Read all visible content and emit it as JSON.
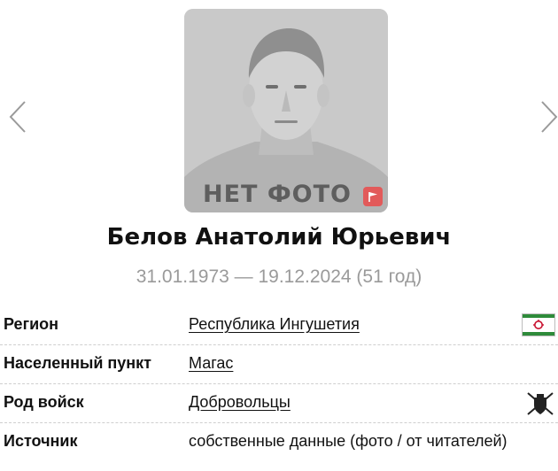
{
  "photo": {
    "placeholder_text": "НЕТ ФОТО"
  },
  "person": {
    "name": "Белов Анатолий Юрьевич",
    "dates": "31.01.1973 — 19.12.2024 (51 год)"
  },
  "info": [
    {
      "label": "Регион",
      "value": "Республика Ингушетия",
      "icon": "ingushetia-flag-icon"
    },
    {
      "label": "Населенный пункт",
      "value": "Магас"
    },
    {
      "label": "Род войск",
      "value": "Добровольцы",
      "icon": "volunteers-emblem-icon"
    },
    {
      "label": "Источник",
      "value": "собственные данные (фото / от читателей)"
    }
  ],
  "colors": {
    "photo_bg": "#c9c9c9",
    "report_flag": "#e25a5a",
    "dates_text": "#9a9a9a",
    "flag_green": "#2e8b3a",
    "flag_red": "#c8102e"
  }
}
